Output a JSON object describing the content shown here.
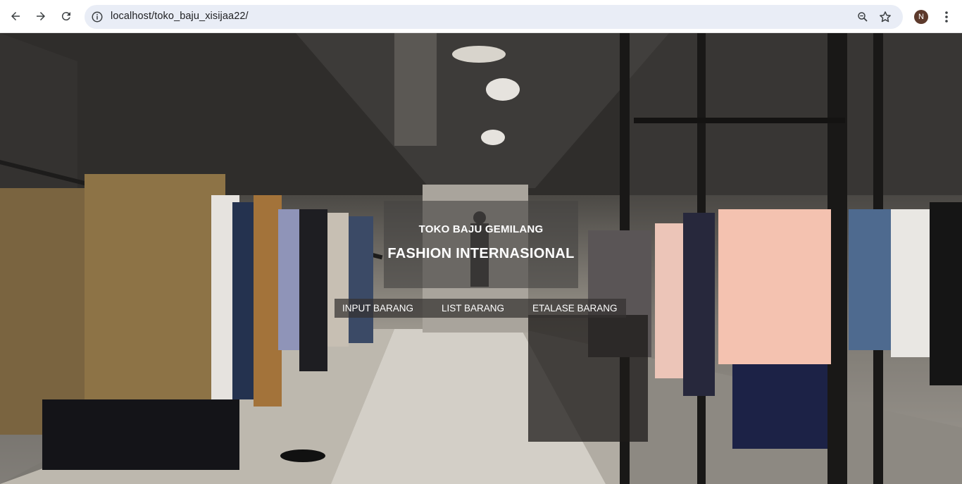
{
  "browser": {
    "url": "localhost/toko_baju_xisijaa22/",
    "profile_initial": "N",
    "icons": [
      "back-arrow-icon",
      "forward-arrow-icon",
      "reload-icon",
      "site-info-icon",
      "zoom-icon",
      "star-icon",
      "kebab-menu-icon"
    ]
  },
  "page": {
    "store_name": "TOKO BAJU GEMILANG",
    "tagline": "FASHION INTERNASIONAL",
    "nav": [
      {
        "label": "INPUT BARANG"
      },
      {
        "label": "LIST BARANG"
      },
      {
        "label": "ETALASE BARANG"
      }
    ]
  },
  "colors": {
    "omnibox_bg": "#e9edf6",
    "title_box_bg": "rgba(70,68,66,0.62)",
    "menu_bg": "rgba(52,50,48,0.72)",
    "text_on_dark": "#ffffff"
  }
}
